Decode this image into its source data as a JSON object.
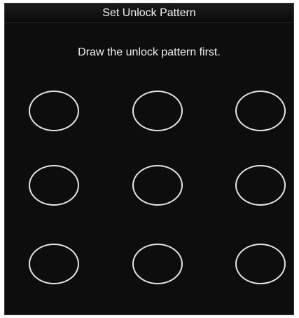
{
  "dialog": {
    "title": "Set Unlock Pattern",
    "instruction": "Draw the unlock pattern first."
  },
  "pattern": {
    "rows": 3,
    "cols": 3
  },
  "colors": {
    "background": "#0d0d0d",
    "text": "#f0f0f0",
    "circle": "#e6e6e6"
  }
}
